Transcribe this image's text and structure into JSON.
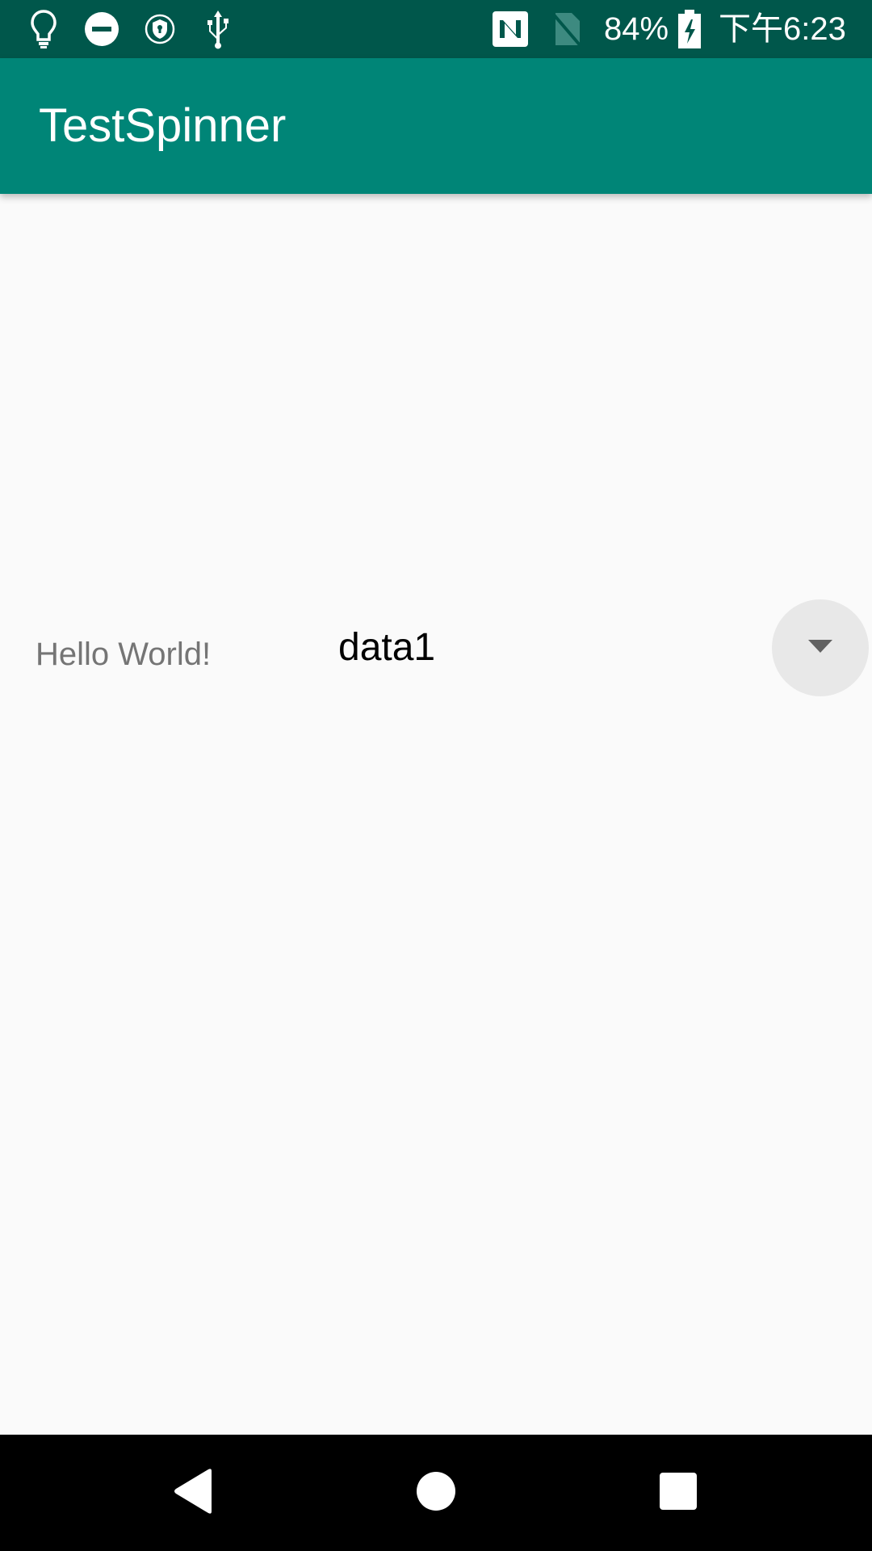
{
  "status_bar": {
    "icons_left": [
      "lightbulb-icon",
      "do-not-disturb-icon",
      "vpn-shield-icon",
      "usb-icon"
    ],
    "icons_right": [
      "nfc-icon",
      "no-sim-icon",
      "battery-charging-icon"
    ],
    "battery": "84%",
    "time": "下午6:23"
  },
  "app_bar": {
    "title": "TestSpinner"
  },
  "content": {
    "hello_text": "Hello World!",
    "spinner": {
      "selected_value": "data1",
      "arrow_icon": "dropdown-arrow-icon"
    }
  },
  "nav_bar": {
    "icons": [
      "back-icon",
      "home-icon",
      "recents-icon"
    ]
  },
  "colors": {
    "status_bar": "#00574b",
    "app_bar": "#008577",
    "background": "#fafafa",
    "nav_bar": "#000000"
  }
}
